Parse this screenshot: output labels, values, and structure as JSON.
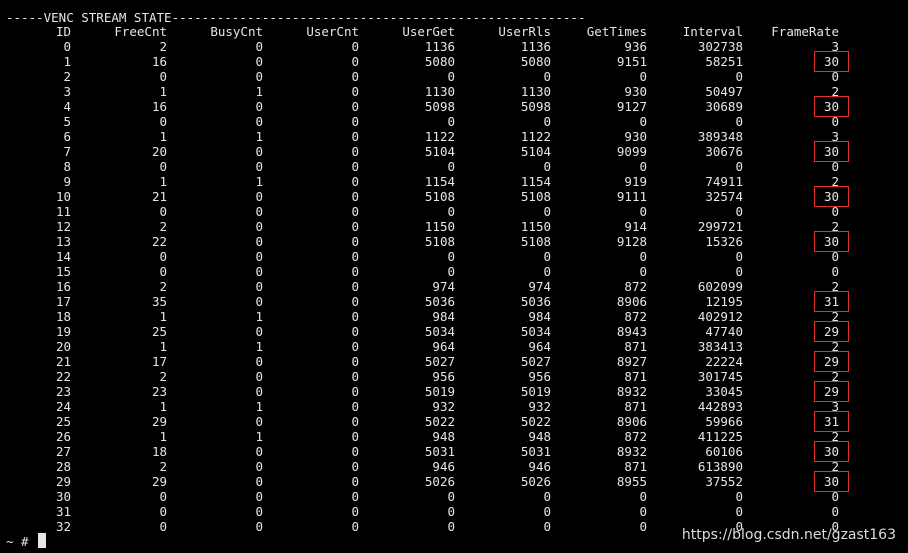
{
  "terminal": {
    "title_line": "-----VENC STREAM STATE-------------------------------------------------------",
    "prompt": "~ #",
    "watermark": "https://blog.csdn.net/gzast163",
    "highlight_color": "#e0302a",
    "headers": [
      "ID",
      "FreeCnt",
      "BusyCnt",
      "UserCnt",
      "UserGet",
      "UserRls",
      "GetTimes",
      "Interval",
      "FrameRate"
    ],
    "rows": [
      [
        "0",
        "2",
        "0",
        "0",
        "1136",
        "1136",
        "936",
        "302738",
        "3"
      ],
      [
        "1",
        "16",
        "0",
        "0",
        "5080",
        "5080",
        "9151",
        "58251",
        "30"
      ],
      [
        "2",
        "0",
        "0",
        "0",
        "0",
        "0",
        "0",
        "0",
        "0"
      ],
      [
        "3",
        "1",
        "1",
        "0",
        "1130",
        "1130",
        "930",
        "50497",
        "2"
      ],
      [
        "4",
        "16",
        "0",
        "0",
        "5098",
        "5098",
        "9127",
        "30689",
        "30"
      ],
      [
        "5",
        "0",
        "0",
        "0",
        "0",
        "0",
        "0",
        "0",
        "0"
      ],
      [
        "6",
        "1",
        "1",
        "0",
        "1122",
        "1122",
        "930",
        "389348",
        "3"
      ],
      [
        "7",
        "20",
        "0",
        "0",
        "5104",
        "5104",
        "9099",
        "30676",
        "30"
      ],
      [
        "8",
        "0",
        "0",
        "0",
        "0",
        "0",
        "0",
        "0",
        "0"
      ],
      [
        "9",
        "1",
        "1",
        "0",
        "1154",
        "1154",
        "919",
        "74911",
        "2"
      ],
      [
        "10",
        "21",
        "0",
        "0",
        "5108",
        "5108",
        "9111",
        "32574",
        "30"
      ],
      [
        "11",
        "0",
        "0",
        "0",
        "0",
        "0",
        "0",
        "0",
        "0"
      ],
      [
        "12",
        "2",
        "0",
        "0",
        "1150",
        "1150",
        "914",
        "299721",
        "2"
      ],
      [
        "13",
        "22",
        "0",
        "0",
        "5108",
        "5108",
        "9128",
        "15326",
        "30"
      ],
      [
        "14",
        "0",
        "0",
        "0",
        "0",
        "0",
        "0",
        "0",
        "0"
      ],
      [
        "15",
        "0",
        "0",
        "0",
        "0",
        "0",
        "0",
        "0",
        "0"
      ],
      [
        "16",
        "2",
        "0",
        "0",
        "974",
        "974",
        "872",
        "602099",
        "2"
      ],
      [
        "17",
        "35",
        "0",
        "0",
        "5036",
        "5036",
        "8906",
        "12195",
        "31"
      ],
      [
        "18",
        "1",
        "1",
        "0",
        "984",
        "984",
        "872",
        "402912",
        "2"
      ],
      [
        "19",
        "25",
        "0",
        "0",
        "5034",
        "5034",
        "8943",
        "47740",
        "29"
      ],
      [
        "20",
        "1",
        "1",
        "0",
        "964",
        "964",
        "871",
        "383413",
        "2"
      ],
      [
        "21",
        "17",
        "0",
        "0",
        "5027",
        "5027",
        "8927",
        "22224",
        "29"
      ],
      [
        "22",
        "2",
        "0",
        "0",
        "956",
        "956",
        "871",
        "301745",
        "2"
      ],
      [
        "23",
        "23",
        "0",
        "0",
        "5019",
        "5019",
        "8932",
        "33045",
        "29"
      ],
      [
        "24",
        "1",
        "1",
        "0",
        "932",
        "932",
        "871",
        "442893",
        "3"
      ],
      [
        "25",
        "29",
        "0",
        "0",
        "5022",
        "5022",
        "8906",
        "59966",
        "31"
      ],
      [
        "26",
        "1",
        "1",
        "0",
        "948",
        "948",
        "872",
        "411225",
        "2"
      ],
      [
        "27",
        "18",
        "0",
        "0",
        "5031",
        "5031",
        "8932",
        "60106",
        "30"
      ],
      [
        "28",
        "2",
        "0",
        "0",
        "946",
        "946",
        "871",
        "613890",
        "2"
      ],
      [
        "29",
        "29",
        "0",
        "0",
        "5026",
        "5026",
        "8955",
        "37552",
        "30"
      ],
      [
        "30",
        "0",
        "0",
        "0",
        "0",
        "0",
        "0",
        "0",
        "0"
      ],
      [
        "31",
        "0",
        "0",
        "0",
        "0",
        "0",
        "0",
        "0",
        "0"
      ],
      [
        "32",
        "0",
        "0",
        "0",
        "0",
        "0",
        "0",
        "0",
        "0"
      ]
    ],
    "highlighted_rows": [
      1,
      4,
      7,
      10,
      13,
      17,
      19,
      21,
      23,
      25,
      27,
      29
    ]
  }
}
